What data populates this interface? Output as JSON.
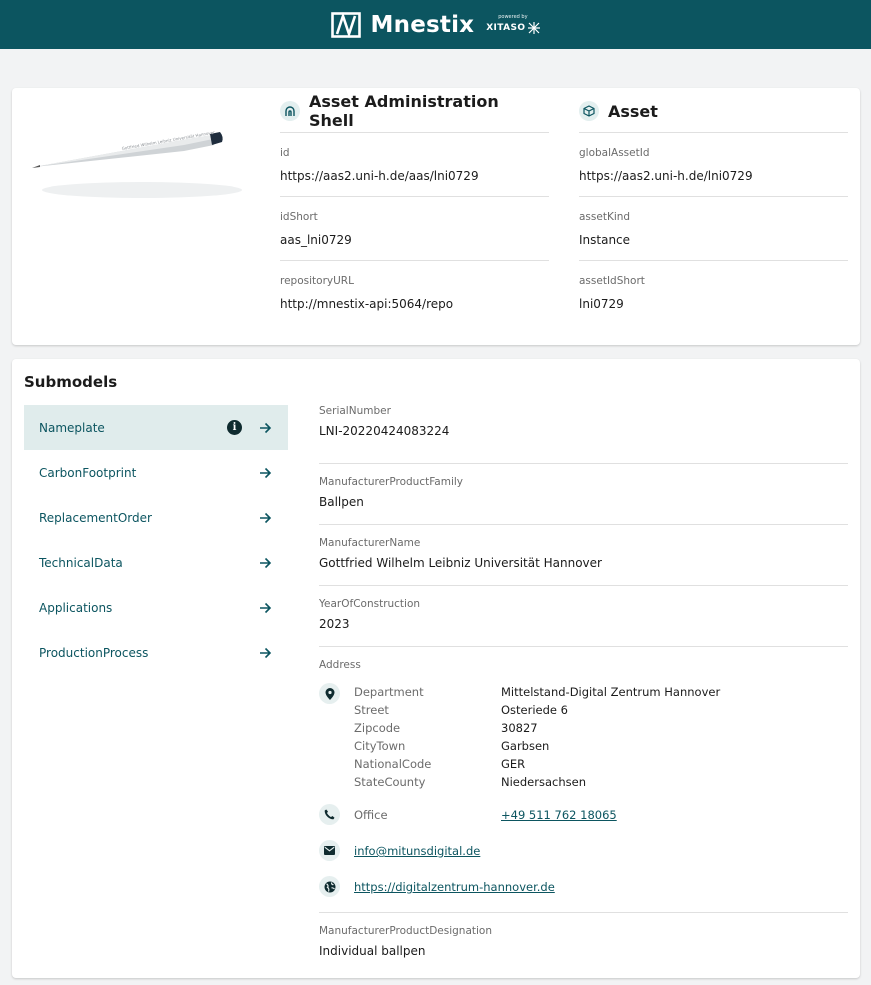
{
  "header": {
    "brand_name": "Mnestix",
    "powered_by": "powered by",
    "partner": "XITASO"
  },
  "product_image": {
    "alt": "Ballpen",
    "engraving": "Gottfried Wilhelm Leibniz Universität Hannover"
  },
  "aas": {
    "title": "Asset Administration Shell",
    "icon": "shell-icon",
    "fields": [
      {
        "label": "id",
        "value": "https://aas2.uni-h.de/aas/lni0729"
      },
      {
        "label": "idShort",
        "value": "aas_lni0729"
      },
      {
        "label": "repositoryURL",
        "value": "http://mnestix-api:5064/repo"
      }
    ]
  },
  "asset": {
    "title": "Asset",
    "icon": "cube-icon",
    "fields": [
      {
        "label": "globalAssetId",
        "value": "https://aas2.uni-h.de/lni0729"
      },
      {
        "label": "assetKind",
        "value": "Instance"
      },
      {
        "label": "assetIdShort",
        "value": "lni0729"
      }
    ]
  },
  "submodels": {
    "title": "Submodels",
    "items": [
      {
        "label": "Nameplate",
        "active": true,
        "info": true
      },
      {
        "label": "CarbonFootprint"
      },
      {
        "label": "ReplacementOrder"
      },
      {
        "label": "TechnicalData"
      },
      {
        "label": "Applications"
      },
      {
        "label": "ProductionProcess"
      }
    ]
  },
  "nameplate": {
    "fields": [
      {
        "label": "SerialNumber",
        "value": "LNI-20220424083224"
      },
      {
        "label": "ManufacturerProductFamily",
        "value": "Ballpen"
      },
      {
        "label": "ManufacturerName",
        "value": "Gottfried Wilhelm Leibniz Universität Hannover"
      },
      {
        "label": "YearOfConstruction",
        "value": "2023"
      }
    ],
    "address": {
      "label": "Address",
      "rows": [
        {
          "key": "Department",
          "value": "Mittelstand-Digital Zentrum Hannover"
        },
        {
          "key": "Street",
          "value": "Osteriede 6"
        },
        {
          "key": "Zipcode",
          "value": "30827"
        },
        {
          "key": "CityTown",
          "value": "Garbsen"
        },
        {
          "key": "NationalCode",
          "value": "GER"
        },
        {
          "key": "StateCounty",
          "value": "Niedersachsen"
        }
      ],
      "phone_key": "Office",
      "phone": "+49 511 762 18065",
      "email": "info@mitunsdigital.de",
      "web": "https://digitalzentrum-hannover.de"
    },
    "designation": {
      "label": "ManufacturerProductDesignation",
      "value": "Individual ballpen"
    }
  },
  "colors": {
    "header_bg": "#0c5560",
    "accent": "#0c5560",
    "active_nav_bg": "#e0ecec"
  }
}
